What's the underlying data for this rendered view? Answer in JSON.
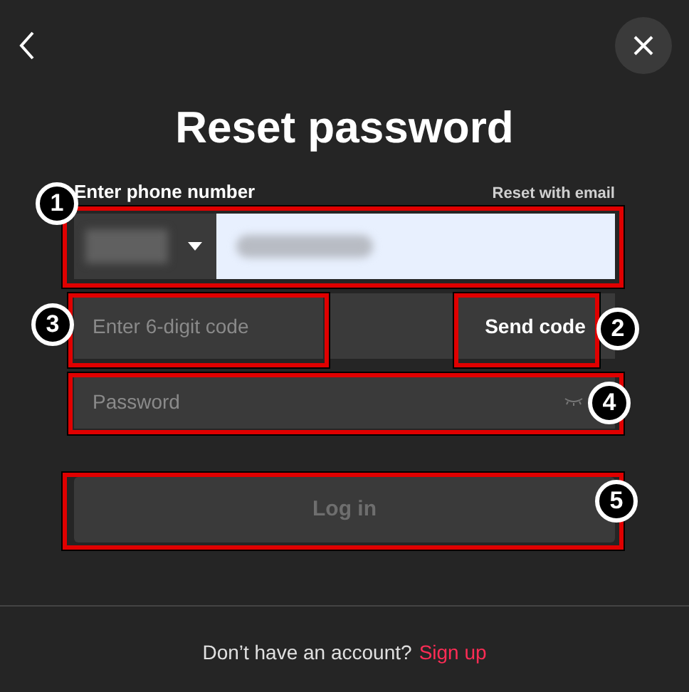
{
  "title": "Reset password",
  "phone": {
    "label": "Enter phone number",
    "alt_link": "Reset with email"
  },
  "code": {
    "placeholder": "Enter 6-digit code",
    "button": "Send code"
  },
  "password": {
    "placeholder": "Password"
  },
  "login": {
    "label": "Log in",
    "disabled": true
  },
  "footer": {
    "text": "Don’t have an account?",
    "link": "Sign up"
  },
  "annotations": [
    {
      "number": "1"
    },
    {
      "number": "3"
    },
    {
      "number": "2"
    },
    {
      "number": "4"
    },
    {
      "number": "5"
    }
  ]
}
